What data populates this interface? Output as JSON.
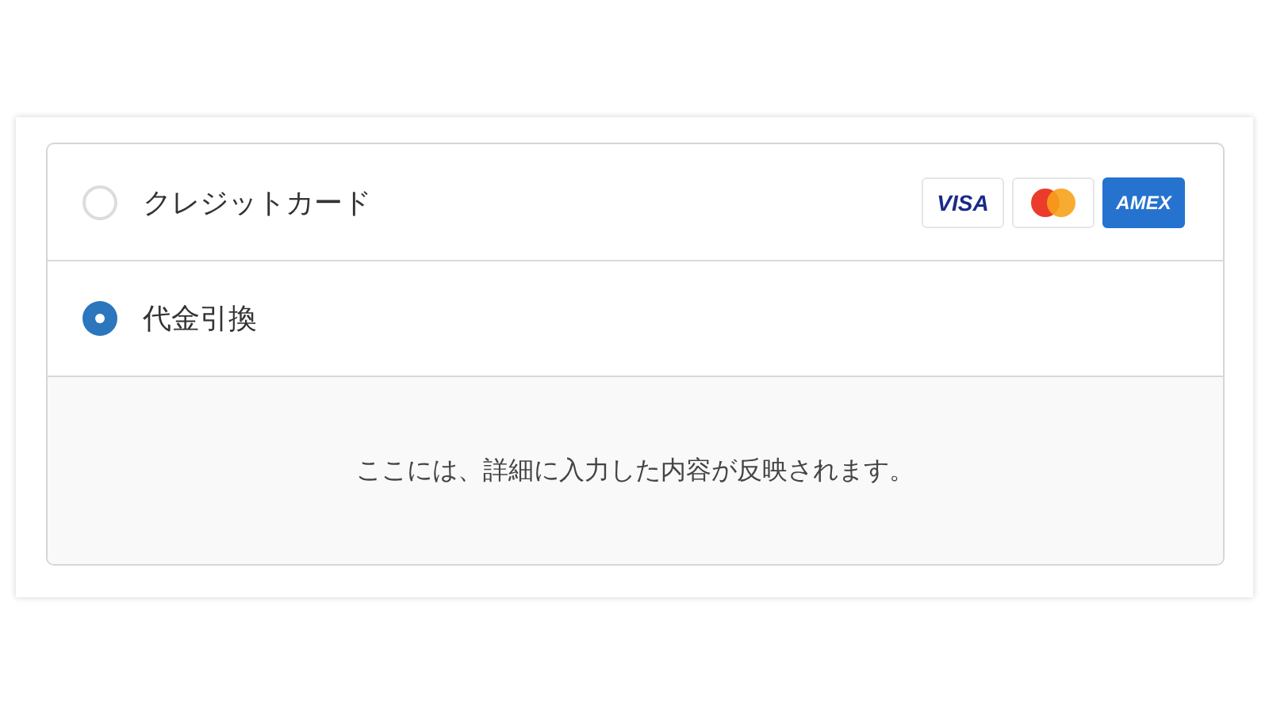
{
  "payment_methods": [
    {
      "label": "クレジットカード",
      "selected": false,
      "cards": [
        {
          "kind": "visa",
          "text": "VISA"
        },
        {
          "kind": "mastercard"
        },
        {
          "kind": "amex",
          "text": "AMEX"
        }
      ]
    },
    {
      "label": "代金引換",
      "selected": true,
      "detail": "ここには、詳細に入力した内容が反映されます。"
    }
  ]
}
